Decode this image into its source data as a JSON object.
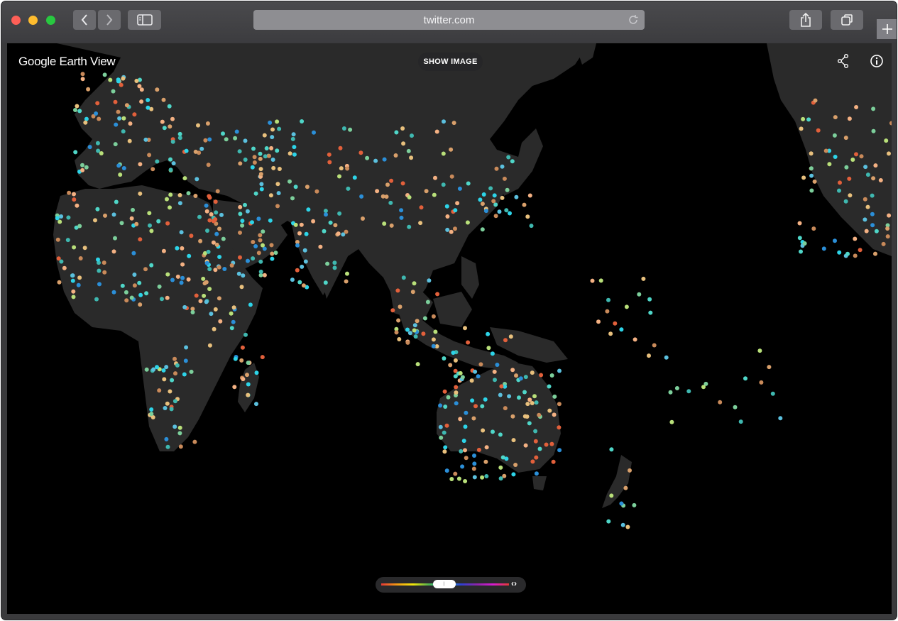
{
  "browser": {
    "url": "twitter.com",
    "icons": [
      "close-light",
      "minimize-light",
      "zoom-light",
      "back-icon",
      "forward-icon",
      "sidebar-icon",
      "reload-icon",
      "share-icon",
      "tabs-icon",
      "plus-icon"
    ]
  },
  "app": {
    "logo": "Google Earth View",
    "show_image_label": "SHOW IMAGE",
    "icons": [
      "share-icon",
      "info-icon"
    ]
  },
  "color_filter": {
    "arrows": "‹›",
    "colors": [
      "#e53935",
      "#f39c12",
      "#f1e70b",
      "#4caf50",
      "#22c5c5",
      "#2e3fd1",
      "#8e24aa",
      "#d81bd1"
    ]
  },
  "map": {
    "land_color": "#2a2a2a",
    "ocean_color": "#000000",
    "marker_colors": [
      "#d9a06b",
      "#3fb8b0",
      "#f4b183",
      "#5bc0de",
      "#e8c07d",
      "#4fd6c8",
      "#c98a5a",
      "#7ccf9b",
      "#2b8fd8",
      "#e2603b",
      "#b9e07a",
      "#2dd4e8"
    ]
  }
}
